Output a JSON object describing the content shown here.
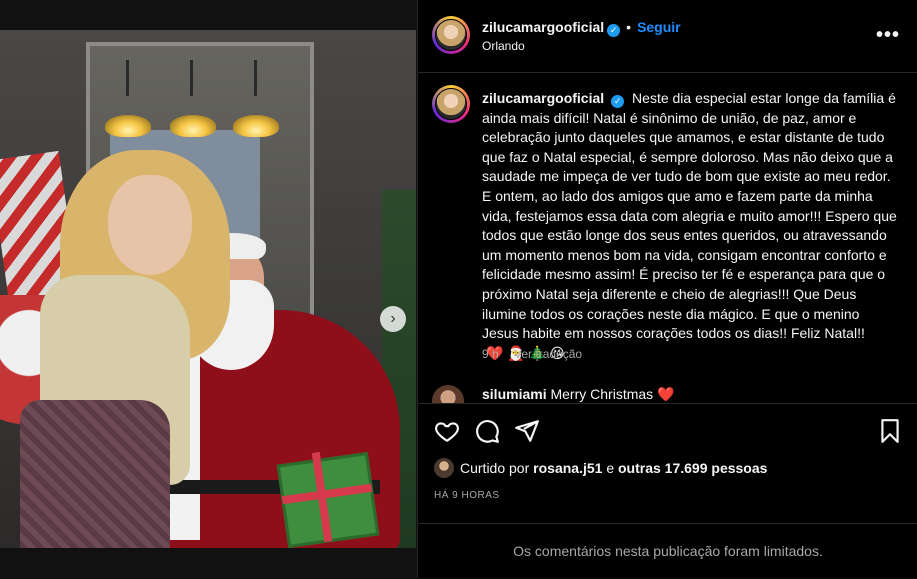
{
  "post": {
    "username": "zilucamargooficial",
    "location": "Orlando",
    "follow_label": "Seguir",
    "separator": "•",
    "more_label": "•••",
    "caption": "Neste dia especial estar longe da família é ainda mais difícil! Natal é sinônimo de união, de paz, amor e celebração junto daqueles que amamos, e estar distante de tudo que faz o Natal especial, é sempre doloroso. Mas não deixo que a saudade me impeça de ver tudo de bom que existe ao meu redor. E ontem, ao lado dos amigos que amo e fazem parte da minha vida, festejamos essa data com alegria e muito amor!!! Espero que todos que estão longe dos seus entes queridos, ou atravessando um momento menos bom na vida, consigam encontrar conforto e felicidade mesmo assim! É preciso ter fé e esperança para que o próximo Natal seja diferente e cheio de alegrias!!! Que Deus ilumine todos os corações neste dia mágico. E que o menino Jesus habite em nossos corações todos os dias!! Feliz Natal!!",
    "caption_emojis": "❤️ 🎅 🎄 😘",
    "caption_age": "9 h",
    "translate_label": "Ver tradução",
    "likes_prefix": "Curtido por",
    "liked_by": "rosana.j51",
    "likes_joiner": "e",
    "likes_others": "outras 17.699 pessoas",
    "timestamp": "HÁ 9 HORAS",
    "comments_limited": "Os comentários nesta publicação foram limitados."
  },
  "comment_preview": {
    "username": "silumiami",
    "text": "Merry Christmas ❤️"
  },
  "carousel": {
    "next_label": "›",
    "dot_count": 7,
    "active_index": 0
  },
  "colors": {
    "accent": "#1f8cff",
    "background": "#000000",
    "verified": "#1d9bf0"
  }
}
